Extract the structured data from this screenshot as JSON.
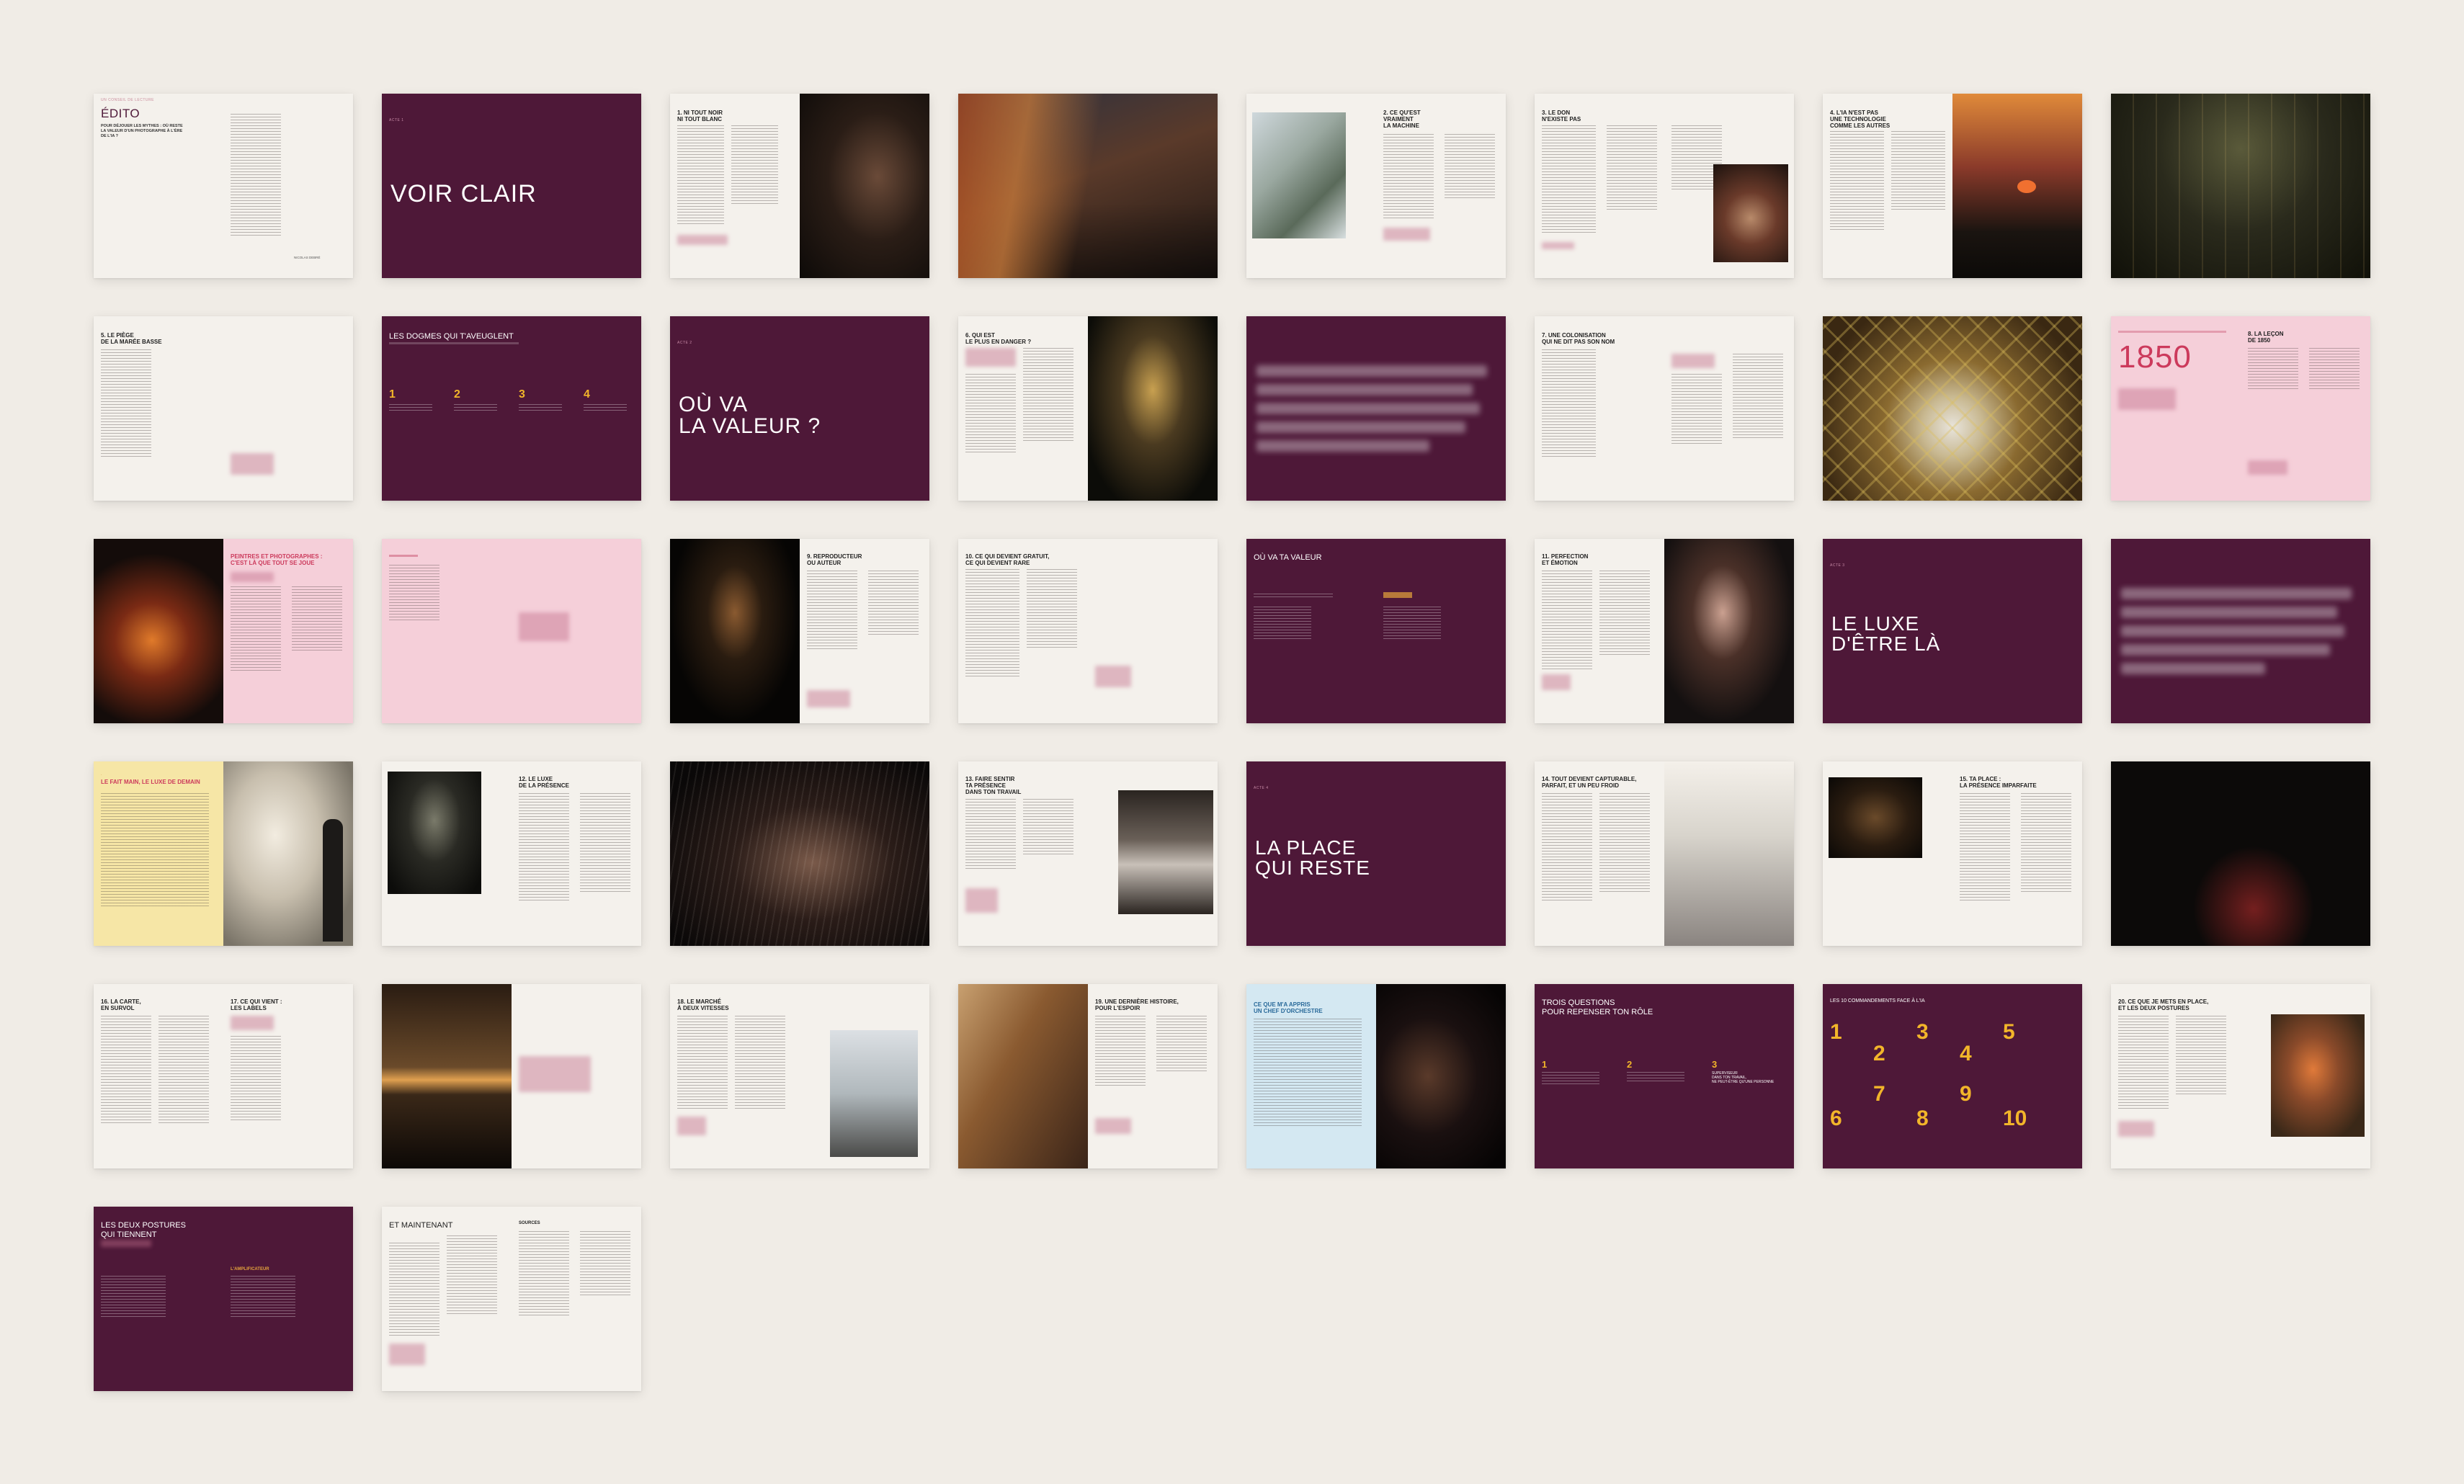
{
  "pages": {
    "p1": {
      "kicker": "UN CONSEIL DE LECTURE",
      "title": "ÉDITO",
      "subtitle": "POUR DÉJOUER LES MYTHES : OÙ RESTE LA VALEUR D'UN PHOTOGRAPHE À L'ÈRE DE L'IA ?",
      "signature": "NICOLAS DEBRÉ"
    },
    "p2": {
      "kicker": "ACTE 1",
      "title": "VOIR CLAIR"
    },
    "p3": {
      "title": "1. NI TOUT NOIR\nNI TOUT BLANC"
    },
    "p5": {
      "title": "2. CE QU'EST\nVRAIMENT\nLA MACHINE"
    },
    "p6": {
      "title": "3. LE DON\nN'EXISTE PAS"
    },
    "p7": {
      "title": "4. L'IA N'EST PAS\nUNE TECHNOLOGIE\nCOMME LES AUTRES"
    },
    "p9": {
      "title": "5. LE PIÈGE\nDE LA MARÉE BASSE"
    },
    "p10": {
      "title": "LES DOGMES QUI T'AVEUGLENT",
      "numbers": [
        "1",
        "2",
        "3",
        "4"
      ]
    },
    "p11": {
      "kicker": "ACTE 2",
      "title": "OÙ VA\nLA VALEUR ?"
    },
    "p12": {
      "title": "6. QUI EST\nLE PLUS EN DANGER ?"
    },
    "p14": {
      "title": "7. UNE COLONISATION\nQUI NE DIT PAS SON NOM"
    },
    "p16": {
      "year": "1850",
      "title": "8. LA LEÇON\nDE 1850"
    },
    "p17": {
      "title": "PEINTRES ET PHOTOGRAPHES :\nC'EST LÀ QUE TOUT SE JOUE"
    },
    "p19": {
      "title": "9. REPRODUCTEUR\nOU AUTEUR"
    },
    "p20": {
      "title": "10. CE QUI DEVIENT GRATUIT,\nCE QUI DEVIENT RARE"
    },
    "p21": {
      "title": "OÙ VA TA VALEUR"
    },
    "p22": {
      "title": "11. PERFECTION\nET ÉMOTION"
    },
    "p23": {
      "kicker": "ACTE 3",
      "title": "LE LUXE\nD'ÊTRE LÀ"
    },
    "p25": {
      "title": "LE FAIT MAIN, LE LUXE DE DEMAIN"
    },
    "p26": {
      "title": "12. LE LUXE\nDE LA PRÉSENCE"
    },
    "p28": {
      "title": "13. FAIRE SENTIR\nTA PRÉSENCE\nDANS TON TRAVAIL"
    },
    "p29": {
      "kicker": "ACTE 4",
      "title": "LA PLACE\nQUI RESTE"
    },
    "p30": {
      "title": "14. TOUT DEVIENT CAPTURABLE,\nPARFAIT, ET UN PEU FROID"
    },
    "p31": {
      "title": "15. TA PLACE :\nLA PRÉSENCE IMPARFAITE"
    },
    "p33": {
      "title_a": "16. LA CARTE,\nEN SURVOL",
      "title_b": "17. CE QUI VIENT :\nLES LABELS"
    },
    "p35": {
      "title": "18. LE MARCHÉ\nÀ DEUX VITESSES"
    },
    "p36": {
      "title": "19. UNE DERNIÈRE HISTOIRE,\nPOUR L'ESPOIR"
    },
    "p37": {
      "title": "CE QUE M'A APPRIS\nUN CHEF D'ORCHESTRE"
    },
    "p38": {
      "title": "TROIS QUESTIONS\nPOUR REPENSER TON RÔLE",
      "numbers": [
        "1",
        "2",
        "3"
      ],
      "q3": "SUPERVISEUR\nDANS TON TRAVAIL,\nNE PEUT-ÊTRE QU'UNE PERSONNE"
    },
    "p39": {
      "title": "LES 10 COMMANDEMENTS FACE À L'IA",
      "numbers": [
        "1",
        "2",
        "3",
        "4",
        "5",
        "6",
        "7",
        "8",
        "9",
        "10"
      ]
    },
    "p40": {
      "title": "20. CE QUE JE METS EN PLACE,\nET LES DEUX POSTURES"
    },
    "p41": {
      "title": "LES DEUX POSTURES\nQUI TIENNENT",
      "label": "L'AMPLIFICATEUR"
    },
    "p42": {
      "title": "ET MAINTENANT",
      "sources": "SOURCES"
    }
  },
  "colors": {
    "background": "#f0ece6",
    "plum": "#4e1838",
    "cream": "#f4f1ec",
    "pink": "#f5cfd9",
    "gold": "#f2b52a",
    "accent_red": "#cc3a5c"
  }
}
